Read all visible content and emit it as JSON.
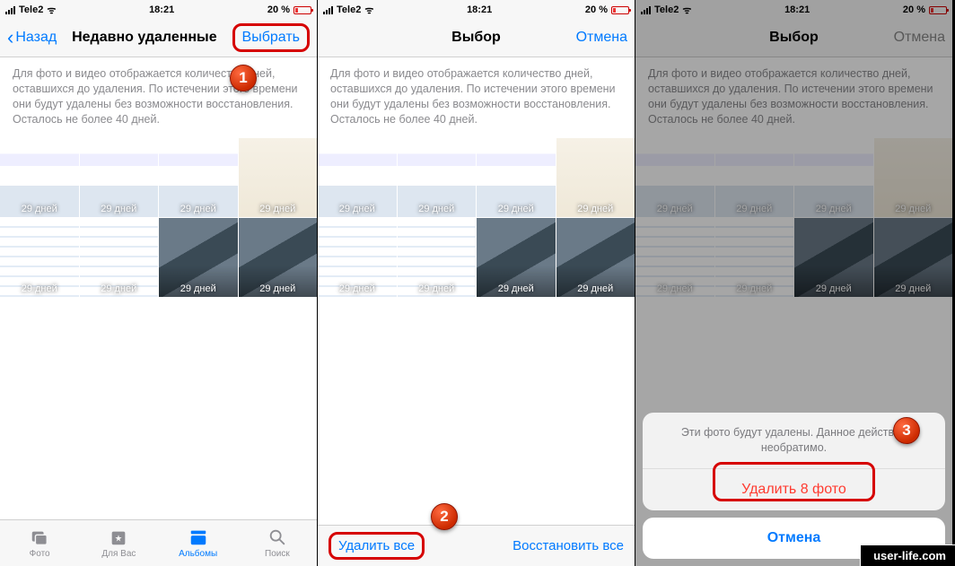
{
  "status": {
    "carrier": "Tele2",
    "time": "18:21",
    "battery_pct": "20 %"
  },
  "screen1": {
    "back_label": "Назад",
    "title": "Недавно удаленные",
    "select_label": "Выбрать",
    "info": "Для фото и видео отображается количество дней, оставшихся до удаления. По истечении этого времени они будут удалены без возможности восстановления. Осталось не более 40 дней.",
    "tabs": {
      "photos": "Фото",
      "for_you": "Для Вас",
      "albums": "Альбомы",
      "search": "Поиск"
    }
  },
  "screen2": {
    "title": "Выбор",
    "cancel_label": "Отмена",
    "info": "Для фото и видео отображается количество дней, оставшихся до удаления. По истечении этого времени они будут удалены без возможности восстановления. Осталось не более 40 дней.",
    "toolbar_left": "Удалить все",
    "toolbar_right": "Восстановить все"
  },
  "screen3": {
    "title": "Выбор",
    "cancel_label": "Отмена",
    "info": "Для фото и видео отображается количество дней, оставшихся до удаления. По истечении этого времени они будут удалены без возможности восстановления. Осталось не более 40 дней.",
    "sheet_message": "Эти фото будут удалены. Данное действие необратимо.",
    "sheet_delete": "Удалить 8 фото",
    "sheet_cancel": "Отмена"
  },
  "thumbs": [
    {
      "variant": "shot",
      "days": "29 дней"
    },
    {
      "variant": "shot",
      "days": "29 дней"
    },
    {
      "variant": "shot",
      "days": "29 дней"
    },
    {
      "variant": "doc",
      "days": "29 дней"
    },
    {
      "variant": "list",
      "days": "29 дней"
    },
    {
      "variant": "list",
      "days": "29 дней"
    },
    {
      "variant": "photo",
      "days": "29 дней"
    },
    {
      "variant": "photo",
      "days": "29 дней"
    }
  ],
  "steps": {
    "s1": "1",
    "s2": "2",
    "s3": "3"
  },
  "watermark": "user-life.com"
}
